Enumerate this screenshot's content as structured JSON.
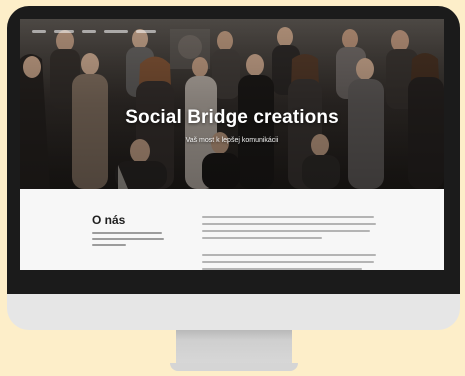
{
  "hero": {
    "title": "Social Bridge creations",
    "subtitle": "Vaš most k lepšej komunikácii"
  },
  "about": {
    "heading": "O nás"
  },
  "colors": {
    "background": "#fdeec9",
    "bezel": "#1b1b1b",
    "chin": "#e6e6e6",
    "hero_text": "#ffffff",
    "section_bg": "#f7f7f7"
  }
}
